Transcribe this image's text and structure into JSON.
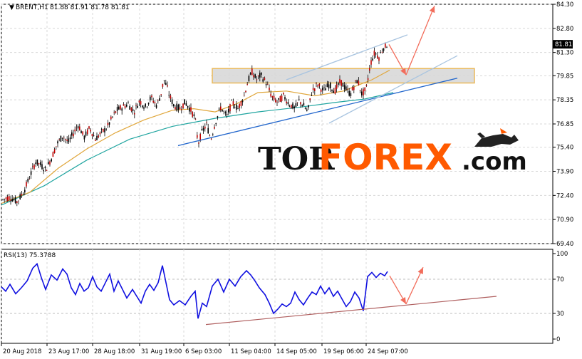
{
  "chart_data": [
    {
      "type": "candlestick",
      "symbol_label": "BRENT,H1",
      "ohlc_label": "81.88 81.91 81.78 81.81",
      "ylim": [
        69.4,
        84.3
      ],
      "y_ticks": [
        "84.30",
        "82.80",
        "81.30",
        "79.85",
        "78.35",
        "76.85",
        "75.40",
        "73.90",
        "72.40",
        "70.90",
        "69.40"
      ],
      "current_price": "81.81",
      "x_ticks": [
        "20 Aug 2018",
        "23 Aug 17:00",
        "28 Aug 18:00",
        "31 Aug 19:00",
        "6 Sep 03:00",
        "11 Sep 04:00",
        "14 Sep 05:00",
        "19 Sep 06:00",
        "24 Sep 07:00"
      ],
      "price_path": [
        [
          0,
          72.1
        ],
        [
          5,
          72.2
        ],
        [
          12,
          72.3
        ],
        [
          22,
          72.0
        ],
        [
          32,
          72.7
        ],
        [
          40,
          73.6
        ],
        [
          48,
          74.5
        ],
        [
          55,
          74.3
        ],
        [
          62,
          74.0
        ],
        [
          70,
          74.7
        ],
        [
          78,
          75.6
        ],
        [
          86,
          76.1
        ],
        [
          94,
          75.7
        ],
        [
          100,
          76.2
        ],
        [
          108,
          76.8
        ],
        [
          116,
          76.0
        ],
        [
          124,
          76.6
        ],
        [
          132,
          75.9
        ],
        [
          140,
          76.3
        ],
        [
          148,
          76.6
        ],
        [
          155,
          77.2
        ],
        [
          162,
          77.7
        ],
        [
          170,
          77.9
        ],
        [
          178,
          78.1
        ],
        [
          186,
          77.6
        ],
        [
          194,
          78.3
        ],
        [
          202,
          77.9
        ],
        [
          210,
          78.5
        ],
        [
          218,
          78.0
        ],
        [
          224,
          78.7
        ],
        [
          228,
          79.6
        ],
        [
          232,
          79.2
        ],
        [
          236,
          78.6
        ],
        [
          242,
          78.0
        ],
        [
          250,
          77.8
        ],
        [
          258,
          78.2
        ],
        [
          266,
          77.7
        ],
        [
          272,
          77.2
        ],
        [
          276,
          75.6
        ],
        [
          282,
          76.4
        ],
        [
          288,
          76.8
        ],
        [
          294,
          75.9
        ],
        [
          300,
          76.9
        ],
        [
          308,
          77.9
        ],
        [
          316,
          77.3
        ],
        [
          324,
          78.2
        ],
        [
          332,
          77.8
        ],
        [
          340,
          78.5
        ],
        [
          346,
          79.5
        ],
        [
          352,
          80.1
        ],
        [
          358,
          79.6
        ],
        [
          364,
          79.9
        ],
        [
          372,
          79.4
        ],
        [
          380,
          78.5
        ],
        [
          388,
          78.2
        ],
        [
          396,
          78.6
        ],
        [
          404,
          78.1
        ],
        [
          412,
          77.8
        ],
        [
          418,
          78.3
        ],
        [
          424,
          78.0
        ],
        [
          430,
          77.6
        ],
        [
          436,
          78.9
        ],
        [
          444,
          79.3
        ],
        [
          452,
          78.9
        ],
        [
          460,
          79.3
        ],
        [
          468,
          78.9
        ],
        [
          476,
          79.5
        ],
        [
          484,
          79.0
        ],
        [
          490,
          78.7
        ],
        [
          496,
          79.3
        ],
        [
          500,
          79.6
        ],
        [
          506,
          78.7
        ],
        [
          512,
          79.0
        ],
        [
          518,
          80.6
        ],
        [
          524,
          81.3
        ],
        [
          530,
          81.0
        ],
        [
          536,
          81.6
        ],
        [
          542,
          81.8
        ]
      ],
      "ma_slow": [
        [
          0,
          71.8
        ],
        [
          60,
          73.0
        ],
        [
          120,
          74.6
        ],
        [
          180,
          75.9
        ],
        [
          240,
          76.7
        ],
        [
          300,
          77.2
        ],
        [
          360,
          77.6
        ],
        [
          420,
          77.9
        ],
        [
          470,
          78.2
        ],
        [
          510,
          78.4
        ],
        [
          550,
          78.8
        ]
      ],
      "ma_fast": [
        [
          0,
          71.9
        ],
        [
          40,
          72.6
        ],
        [
          80,
          74.1
        ],
        [
          120,
          75.3
        ],
        [
          160,
          76.3
        ],
        [
          200,
          77.1
        ],
        [
          240,
          77.7
        ],
        [
          270,
          77.8
        ],
        [
          300,
          77.6
        ],
        [
          330,
          78.1
        ],
        [
          360,
          78.8
        ],
        [
          400,
          78.9
        ],
        [
          440,
          78.6
        ],
        [
          480,
          78.9
        ],
        [
          520,
          79.6
        ],
        [
          545,
          80.2
        ]
      ],
      "resistance_zone": [
        79.4,
        80.3
      ],
      "trend_lines": [
        {
          "color": "#2266cc",
          "points": [
            [
              248,
              75.5
            ],
            [
              640,
              79.7
            ]
          ]
        },
        {
          "color": "#a8c4e0",
          "points": [
            [
              400,
              79.6
            ],
            [
              570,
              82.4
            ]
          ]
        },
        {
          "color": "#a8c4e0",
          "points": [
            [
              460,
              76.9
            ],
            [
              640,
              81.1
            ]
          ]
        }
      ],
      "forecast_arrows": [
        {
          "from": [
            544,
            81.8
          ],
          "to": [
            568,
            79.9
          ]
        },
        {
          "from": [
            568,
            79.9
          ],
          "to": [
            608,
            84.2
          ]
        }
      ]
    },
    {
      "type": "line",
      "label": "RSI(13) 75.3788",
      "ylim": [
        0,
        100
      ],
      "y_ticks": [
        "100",
        "70",
        "30",
        "0"
      ],
      "levels": [
        70,
        30
      ],
      "series": [
        [
          0,
          61
        ],
        [
          6,
          56
        ],
        [
          12,
          64
        ],
        [
          20,
          53
        ],
        [
          28,
          60
        ],
        [
          36,
          68
        ],
        [
          44,
          83
        ],
        [
          50,
          88
        ],
        [
          56,
          72
        ],
        [
          62,
          58
        ],
        [
          70,
          75
        ],
        [
          78,
          69
        ],
        [
          86,
          82
        ],
        [
          92,
          76
        ],
        [
          98,
          60
        ],
        [
          104,
          52
        ],
        [
          110,
          65
        ],
        [
          116,
          56
        ],
        [
          122,
          60
        ],
        [
          128,
          73
        ],
        [
          134,
          61
        ],
        [
          140,
          56
        ],
        [
          146,
          66
        ],
        [
          152,
          76
        ],
        [
          158,
          56
        ],
        [
          164,
          68
        ],
        [
          170,
          58
        ],
        [
          176,
          48
        ],
        [
          184,
          58
        ],
        [
          190,
          50
        ],
        [
          196,
          42
        ],
        [
          202,
          56
        ],
        [
          208,
          64
        ],
        [
          214,
          57
        ],
        [
          220,
          66
        ],
        [
          226,
          86
        ],
        [
          230,
          70
        ],
        [
          236,
          46
        ],
        [
          242,
          40
        ],
        [
          250,
          45
        ],
        [
          258,
          40
        ],
        [
          266,
          50
        ],
        [
          272,
          56
        ],
        [
          276,
          24
        ],
        [
          282,
          42
        ],
        [
          288,
          38
        ],
        [
          296,
          62
        ],
        [
          304,
          70
        ],
        [
          312,
          55
        ],
        [
          320,
          70
        ],
        [
          328,
          62
        ],
        [
          336,
          73
        ],
        [
          344,
          80
        ],
        [
          350,
          75
        ],
        [
          356,
          68
        ],
        [
          362,
          60
        ],
        [
          370,
          52
        ],
        [
          376,
          42
        ],
        [
          382,
          30
        ],
        [
          388,
          35
        ],
        [
          394,
          41
        ],
        [
          400,
          38
        ],
        [
          406,
          42
        ],
        [
          412,
          55
        ],
        [
          418,
          46
        ],
        [
          424,
          40
        ],
        [
          430,
          48
        ],
        [
          436,
          55
        ],
        [
          442,
          52
        ],
        [
          448,
          62
        ],
        [
          454,
          53
        ],
        [
          460,
          60
        ],
        [
          466,
          50
        ],
        [
          472,
          56
        ],
        [
          478,
          47
        ],
        [
          484,
          38
        ],
        [
          490,
          44
        ],
        [
          496,
          55
        ],
        [
          502,
          48
        ],
        [
          508,
          33
        ],
        [
          514,
          73
        ],
        [
          520,
          78
        ],
        [
          526,
          72
        ],
        [
          532,
          77
        ],
        [
          538,
          74
        ],
        [
          542,
          79
        ]
      ],
      "trend_line": {
        "color": "#b06060",
        "points": [
          [
            287,
            17
          ],
          [
            695,
            50
          ]
        ]
      },
      "forecast_arrows": [
        {
          "from": [
            545,
            74
          ],
          "to": [
            568,
            41
          ]
        },
        {
          "from": [
            568,
            41
          ],
          "to": [
            592,
            84
          ]
        }
      ]
    }
  ],
  "watermark": {
    "brand_dark": "TOR",
    "brand_accent": "FOREX",
    "suffix": ".com",
    "accent_color": "#ff5a00"
  }
}
